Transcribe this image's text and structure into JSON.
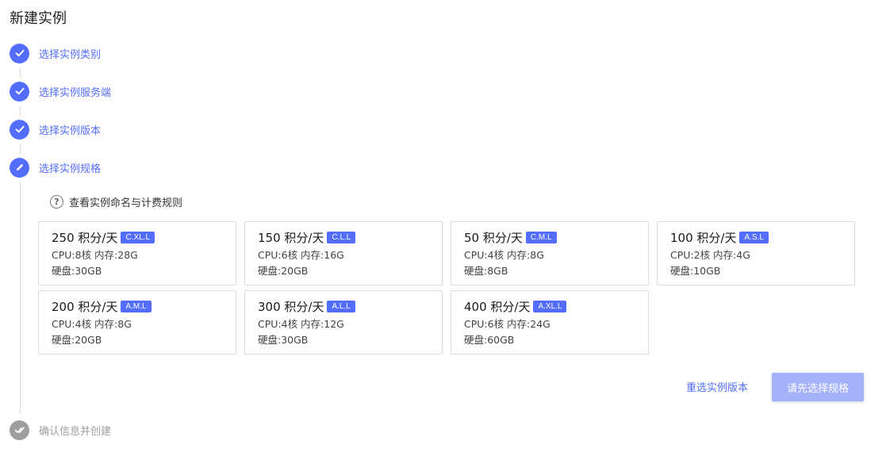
{
  "page": {
    "title": "新建实例"
  },
  "steps": [
    {
      "label": "选择实例类别",
      "state": "done",
      "icon": "check-icon"
    },
    {
      "label": "选择实例服务端",
      "state": "done",
      "icon": "check-icon"
    },
    {
      "label": "选择实例版本",
      "state": "done",
      "icon": "check-icon"
    },
    {
      "label": "选择实例规格",
      "state": "active",
      "icon": "pencil-icon"
    },
    {
      "label": "确认信息并创建",
      "state": "pending",
      "icon": "double-check-icon"
    }
  ],
  "help": {
    "text": "查看实例命名与计费规则",
    "icon": "question-circle-icon"
  },
  "specs": [
    {
      "price": "250 积分/天",
      "badge": "C.XL.L",
      "resources": "CPU:8核 内存:28G",
      "disk": "硬盘:30GB"
    },
    {
      "price": "150 积分/天",
      "badge": "C.L.L",
      "resources": "CPU:6核 内存:16G",
      "disk": "硬盘:20GB"
    },
    {
      "price": "50 积分/天",
      "badge": "C.M.L",
      "resources": "CPU:4核 内存:8G",
      "disk": "硬盘:8GB"
    },
    {
      "price": "100 积分/天",
      "badge": "A.S.L",
      "resources": "CPU:2核 内存:4G",
      "disk": "硬盘:10GB"
    },
    {
      "price": "200 积分/天",
      "badge": "A.M.L",
      "resources": "CPU:4核 内存:8G",
      "disk": "硬盘:20GB"
    },
    {
      "price": "300 积分/天",
      "badge": "A.L.L",
      "resources": "CPU:4核 内存:12G",
      "disk": "硬盘:30GB"
    },
    {
      "price": "400 积分/天",
      "badge": "A.XL.L",
      "resources": "CPU:6核 内存:24G",
      "disk": "硬盘:60GB"
    }
  ],
  "actions": {
    "reselect_label": "重选实例版本",
    "submit_label": "请先选择规格"
  },
  "colors": {
    "accent": "#536dfe",
    "disabled_button": "#a4b1fb",
    "inactive": "#9e9e9e"
  }
}
